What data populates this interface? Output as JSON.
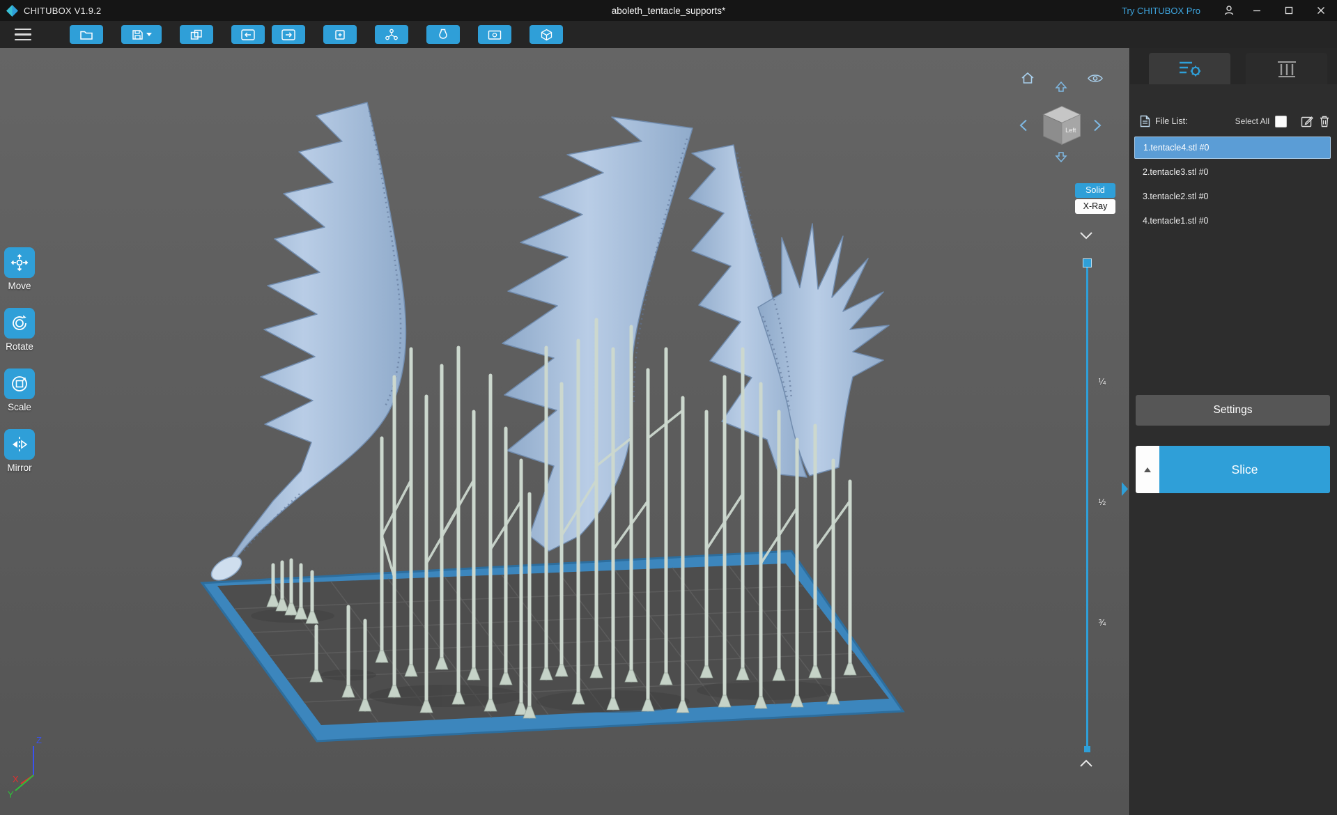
{
  "titlebar": {
    "app_title": "CHITUBOX V1.9.2",
    "document_title": "aboleth_tentacle_supports*",
    "pro_link": "Try CHITUBOX Pro"
  },
  "toolbar": {
    "buttons": [
      {
        "icon": "open-folder-icon"
      },
      {
        "icon": "save-icon",
        "has_dropdown": true
      },
      {
        "icon": "copy-icon"
      },
      {
        "icon": "undo-icon"
      },
      {
        "icon": "redo-icon"
      },
      {
        "icon": "duplicate-icon"
      },
      {
        "icon": "network-send-icon"
      },
      {
        "icon": "hollow-icon"
      },
      {
        "icon": "screenshot-icon"
      },
      {
        "icon": "print-box-icon"
      }
    ]
  },
  "left_toolbar": {
    "tools": [
      {
        "label": "Move",
        "icon": "move-icon"
      },
      {
        "label": "Rotate",
        "icon": "rotate-icon"
      },
      {
        "label": "Scale",
        "icon": "scale-icon"
      },
      {
        "label": "Mirror",
        "icon": "mirror-icon"
      }
    ]
  },
  "viewport": {
    "view_cube": {
      "front_label": "Left"
    },
    "render_modes": {
      "solid": "Solid",
      "xray": "X-Ray",
      "active": "Solid"
    },
    "layer_slider": {
      "labels": [
        "¼",
        "½",
        "¾"
      ]
    },
    "axes": {
      "x": "X",
      "y": "Y",
      "z": "Z"
    }
  },
  "right_panel": {
    "tabs": [
      {
        "name": "file-settings",
        "icon": "list-gear-icon",
        "active": true
      },
      {
        "name": "support-settings",
        "icon": "support-pillars-icon",
        "active": false
      }
    ],
    "file_list": {
      "header": "File List:",
      "select_all": "Select All",
      "select_all_checked": false,
      "files": [
        {
          "name": "1.tentacle4.stl #0",
          "selected": true
        },
        {
          "name": "2.tentacle3.stl #0",
          "selected": false
        },
        {
          "name": "3.tentacle2.stl #0",
          "selected": false
        },
        {
          "name": "4.tentacle1.stl #0",
          "selected": false
        }
      ]
    },
    "buttons": {
      "settings": "Settings",
      "slice": "Slice"
    }
  },
  "colors": {
    "accent": "#2f9fd8",
    "selected_file_row": "#5b9dd6",
    "slice_button": "#2f9fd8",
    "settings_button": "#565656",
    "build_plate_rim": "#3c86bd",
    "model": "#a9c2df",
    "supports": "#ccd8ce"
  }
}
